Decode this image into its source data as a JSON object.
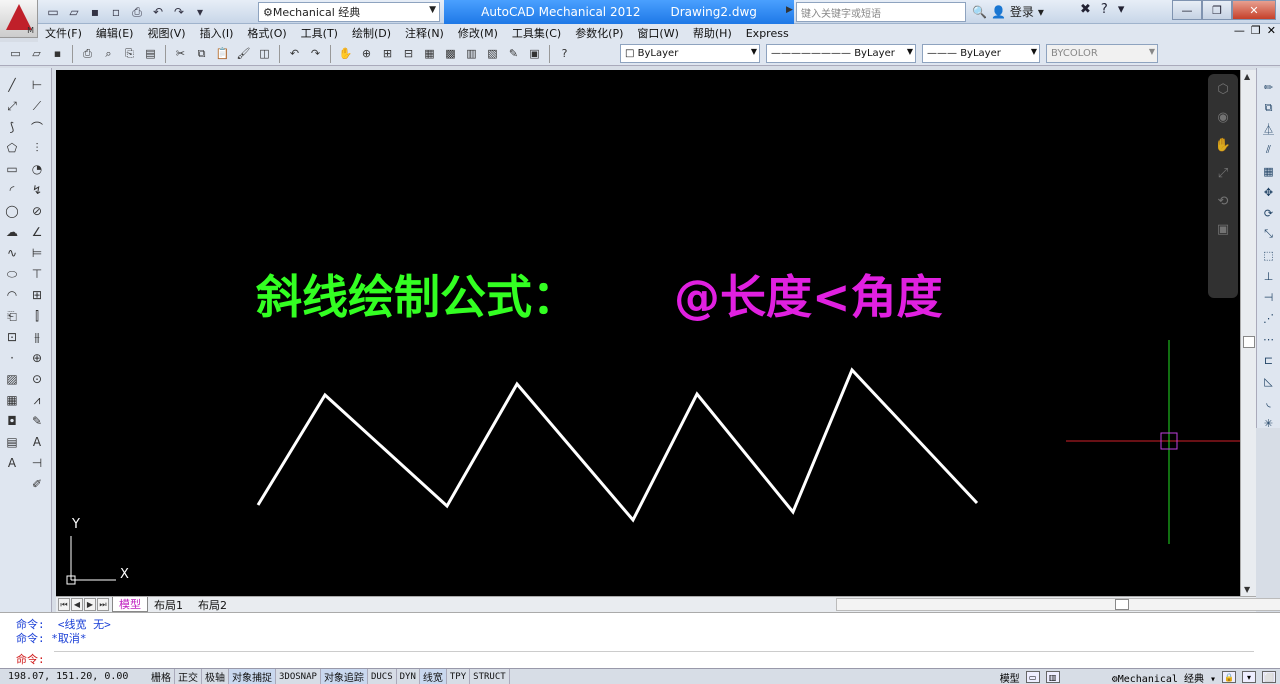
{
  "title_bar": {
    "workspace": "Mechanical 经典",
    "app_name": "AutoCAD Mechanical 2012",
    "file_name": "Drawing2.dwg",
    "search_placeholder": "键入关键字或短语",
    "login": "登录"
  },
  "menu": {
    "items": [
      "文件(F)",
      "编辑(E)",
      "视图(V)",
      "插入(I)",
      "格式(O)",
      "工具(T)",
      "绘制(D)",
      "注释(N)",
      "修改(M)",
      "工具集(C)",
      "参数化(P)",
      "窗口(W)",
      "帮助(H)",
      "Express"
    ]
  },
  "toolbar": {
    "color_combo": "ByLayer",
    "linetype_combo": "ByLayer",
    "lineweight_combo": "ByLayer",
    "plotstyle_combo": "BYCOLOR"
  },
  "drawing": {
    "title_part1": "斜线绘制公式：",
    "title_part2": "@长度<角度",
    "title_color1": "#33ff22",
    "title_color2": "#e020e0",
    "ucs_y": "Y",
    "ucs_x": "X"
  },
  "tabs": {
    "model": "模型",
    "layout1": "布局1",
    "layout2": "布局2"
  },
  "command": {
    "line1_prompt": "命令:",
    "line1_text": "<线宽 无>",
    "line2_prompt": "命令:",
    "line2_text": "*取消*",
    "line3_prompt": "命令:"
  },
  "status": {
    "coords": "198.07, 151.20, 0.00",
    "toggles": [
      {
        "label": "栅格",
        "on": false
      },
      {
        "label": "正交",
        "on": false
      },
      {
        "label": "极轴",
        "on": false
      },
      {
        "label": "对象捕捉",
        "on": true
      },
      {
        "label": "3DOSNAP",
        "on": false
      },
      {
        "label": "对象追踪",
        "on": true
      },
      {
        "label": "DUCS",
        "on": false
      },
      {
        "label": "DYN",
        "on": false
      },
      {
        "label": "线宽",
        "on": true
      },
      {
        "label": "TPY",
        "on": false
      },
      {
        "label": "STRUCT",
        "on": false
      }
    ],
    "model_label": "模型",
    "workspace": "Mechanical 经典"
  }
}
